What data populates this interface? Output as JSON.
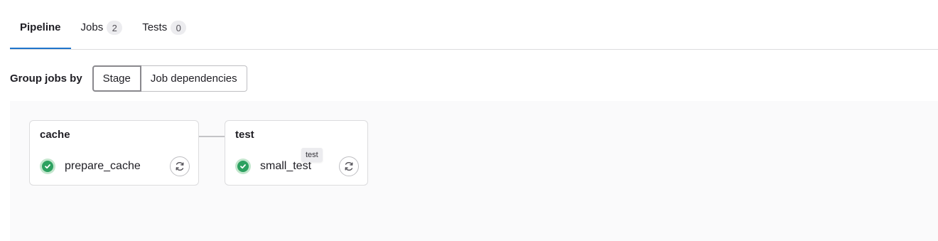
{
  "tabs": [
    {
      "label": "Pipeline",
      "count": null,
      "active": true
    },
    {
      "label": "Jobs",
      "count": "2",
      "active": false
    },
    {
      "label": "Tests",
      "count": "0",
      "active": false
    }
  ],
  "group_by": {
    "label": "Group jobs by",
    "options": [
      "Stage",
      "Job dependencies"
    ],
    "selected": "Stage"
  },
  "stages": [
    {
      "title": "cache",
      "jobs": [
        {
          "name": "prepare_cache",
          "status": "success",
          "action_icon": "retry-icon"
        }
      ]
    },
    {
      "title": "test",
      "jobs": [
        {
          "name": "small_test",
          "status": "success",
          "action_icon": "retry-icon",
          "tooltip": "test"
        }
      ]
    }
  ],
  "colors": {
    "accent": "#1f75cb",
    "success": "#2da160",
    "success_bg": "#c3e6cd",
    "pipeline_bg": "#fafafb"
  }
}
